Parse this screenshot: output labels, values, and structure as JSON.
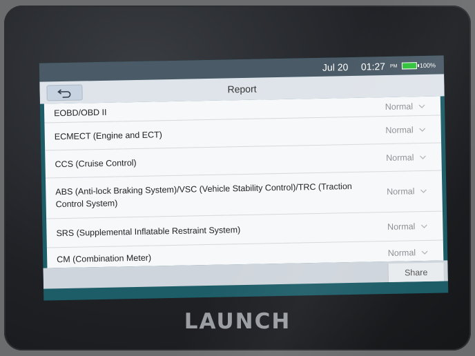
{
  "device": {
    "brand": "LAUNCH"
  },
  "status_bar": {
    "date": "Jul 20",
    "time": "01:27",
    "ampm": "PM",
    "battery": "100%",
    "battery_level": 1.0,
    "battery_color": "#2fc23a"
  },
  "header": {
    "title": "Report",
    "back_icon": "back-arrow-icon"
  },
  "rows": [
    {
      "name": "EOBD/OBD II",
      "status": "Normal"
    },
    {
      "name": "ECMECT (Engine and ECT)",
      "status": "Normal"
    },
    {
      "name": "CCS (Cruise Control)",
      "status": "Normal"
    },
    {
      "name": "ABS (Anti-lock Braking System)/VSC (Vehicle Stability Control)/TRC (Traction Control System)",
      "status": "Normal"
    },
    {
      "name": "SRS (Supplemental Inflatable Restraint System)",
      "status": "Normal"
    },
    {
      "name": "CM (Combination Meter)",
      "status": "Normal"
    }
  ],
  "footer": {
    "share_label": "Share"
  },
  "colors": {
    "accent": "#1d5d68",
    "header_bg": "#dfe4ea",
    "status_text": "#8a8d92"
  }
}
